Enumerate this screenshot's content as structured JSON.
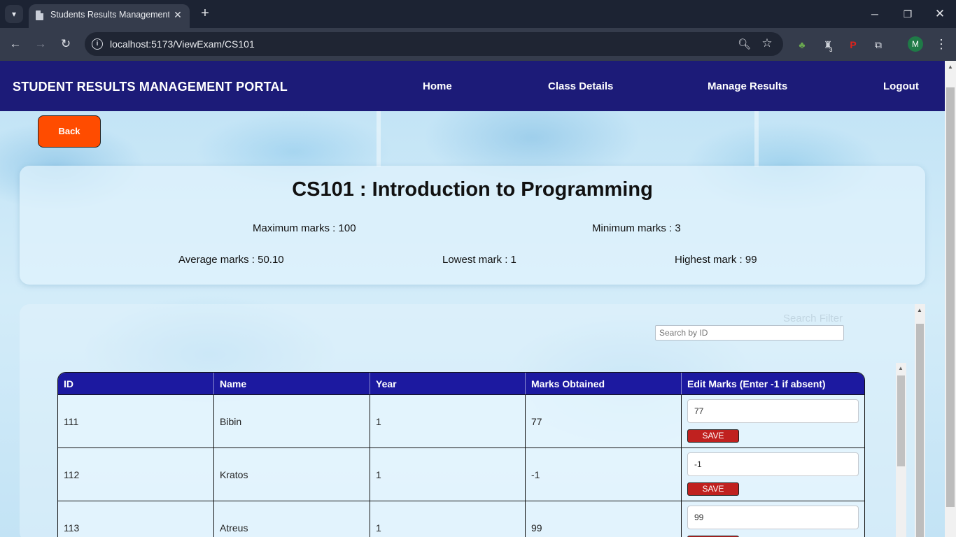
{
  "browser": {
    "tab_title": "Students Results Management Portal",
    "url": "localhost:5173/ViewExam/CS101",
    "profile_initial": "M",
    "extension_badge": "3"
  },
  "navbar": {
    "brand": "STUDENT RESULTS MANAGEMENT PORTAL",
    "links": [
      "Home",
      "Class Details",
      "Manage Results",
      "Logout"
    ]
  },
  "back_label": "Back",
  "exam": {
    "title": "CS101 : Introduction to Programming",
    "max_marks": "Maximum marks : 100",
    "min_marks": "Minimum marks : 3",
    "average": "Average marks : 50.10",
    "lowest": "Lowest mark : 1",
    "highest": "Highest mark : 99"
  },
  "search": {
    "label": "Search Filter",
    "placeholder": "Search by ID"
  },
  "table": {
    "headers": [
      "ID",
      "Name",
      "Year",
      "Marks Obtained",
      "Edit Marks (Enter -1 if absent)"
    ],
    "save_label": "SAVE",
    "rows": [
      {
        "id": "111",
        "name": "Bibin",
        "year": "1",
        "marks": "77",
        "edit_value": "77"
      },
      {
        "id": "112",
        "name": "Kratos",
        "year": "1",
        "marks": "-1",
        "edit_value": "-1"
      },
      {
        "id": "113",
        "name": "Atreus",
        "year": "1",
        "marks": "99",
        "edit_value": "99"
      }
    ]
  }
}
